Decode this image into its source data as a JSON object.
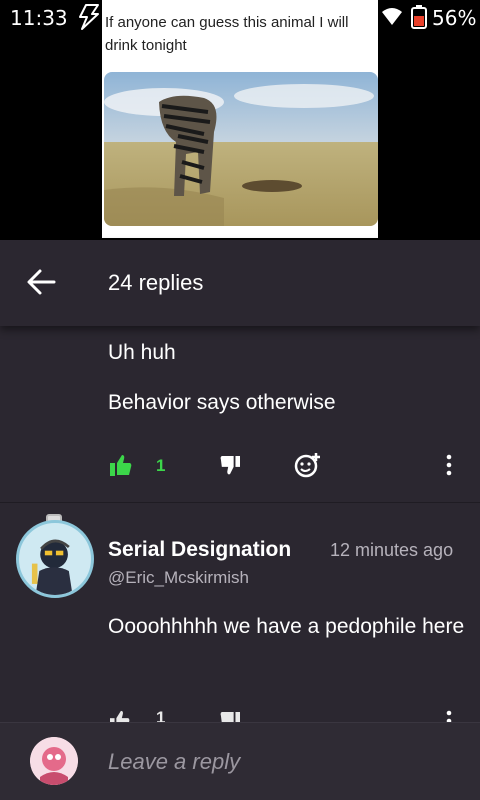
{
  "status_bar": {
    "time": "11:33",
    "battery_percent": "56%",
    "icons": [
      "bolt-icon",
      "wifi-icon",
      "battery-icon"
    ]
  },
  "post": {
    "caption": "If anyone can guess this animal I will drink tonight"
  },
  "header": {
    "title": "24 replies",
    "back_icon": "arrow-left-icon"
  },
  "comments": [
    {
      "lines": [
        "Uh huh",
        "Behavior says otherwise"
      ],
      "likes": "1",
      "liked": true
    },
    {
      "author": "Serial Designation",
      "handle": "@Eric_Mcskirmish",
      "time_ago": "12 minutes ago",
      "text": "Oooohhhhh we have a pedophile here",
      "likes": "1"
    }
  ],
  "composer": {
    "placeholder": "Leave a reply"
  },
  "colors": {
    "background": "#2b2730",
    "liked_green": "#3cd64a",
    "secondary_text": "#b6b2bb"
  }
}
